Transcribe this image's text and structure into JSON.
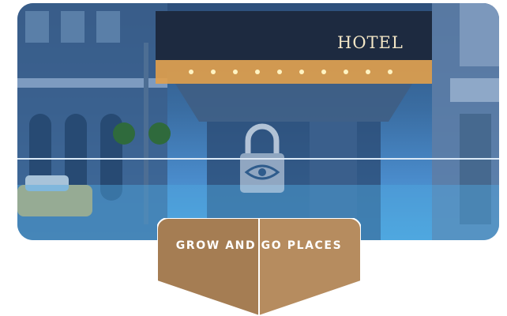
{
  "hero": {
    "sign_text": "HOTEL",
    "overlay_icon": "lock-eye-icon"
  },
  "banner": {
    "label": "GROW AND GO PLACES",
    "left_color": "#a57d53",
    "right_color": "#b68c5f"
  },
  "colors": {
    "hero_top": "#2d4f7a",
    "hero_bottom": "#4fa8e0"
  }
}
